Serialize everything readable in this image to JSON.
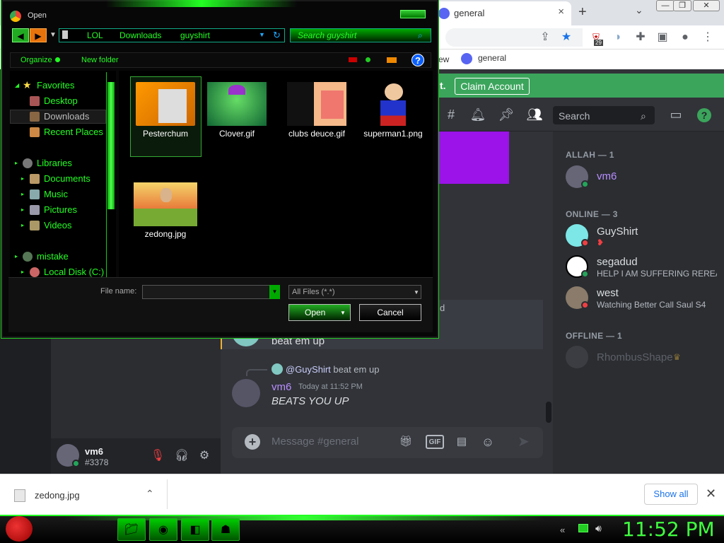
{
  "chrome": {
    "tab_title": "general",
    "tab_close": "×",
    "tab_new": "+",
    "tab_list": "⌄",
    "win_min": "—",
    "win_max": "❐",
    "win_close": "✕",
    "bookmarks_view": "ew",
    "bookmark_general": "general",
    "extension_badge": "29"
  },
  "discord": {
    "notice_text": "t.",
    "claim_button": "Claim Account",
    "search_placeholder": "Search",
    "embed_fragment": "d",
    "embed_text": "beat em up",
    "reply_user": "@GuyShirt",
    "reply_text": " beat em up",
    "message": {
      "author": "vm6",
      "time": "Today at 11:52 PM",
      "body": "BEATS YOU UP"
    },
    "message_placeholder": "Message #general",
    "gif_label": "GIF",
    "user": {
      "name": "vm6",
      "tag": "#3378"
    },
    "members": {
      "allah_header": "ALLAH — 1",
      "allah_member": "vm6",
      "online_header": "ONLINE — 3",
      "online": [
        {
          "name": "GuyShirt",
          "activity": ""
        },
        {
          "name": "segadud",
          "activity": "HELP I AM SUFFERING REREA..."
        },
        {
          "name": "west",
          "activity": "Watching Better Call Saul S4"
        }
      ],
      "offline_header": "OFFLINE — 1",
      "offline_member": "RhombusShape"
    }
  },
  "dialog": {
    "title": "Open",
    "crumbs": [
      "LOL",
      "Downloads",
      "guyshirt"
    ],
    "search_placeholder": "Search guyshirt",
    "organize": "Organize",
    "new_folder": "New folder",
    "nav": {
      "favorites": "Favorites",
      "desktop": "Desktop",
      "downloads": "Downloads",
      "recent": "Recent Places",
      "libraries": "Libraries",
      "documents": "Documents",
      "music": "Music",
      "pictures": "Pictures",
      "videos": "Videos",
      "mistake": "mistake",
      "local_disk": "Local Disk (C:)"
    },
    "files": [
      "Pesterchum",
      "Clover.gif",
      "clubs deuce.gif",
      "superman1.png",
      "zedong.jpg"
    ],
    "file_name_label": "File name:",
    "file_name_value": "",
    "filter": "All Files (*.*)",
    "open_button": "Open",
    "cancel_button": "Cancel"
  },
  "download_bar": {
    "file": "zedong.jpg",
    "show_all": "Show all",
    "close": "✕"
  },
  "taskbar": {
    "clock": "11:52 PM"
  }
}
